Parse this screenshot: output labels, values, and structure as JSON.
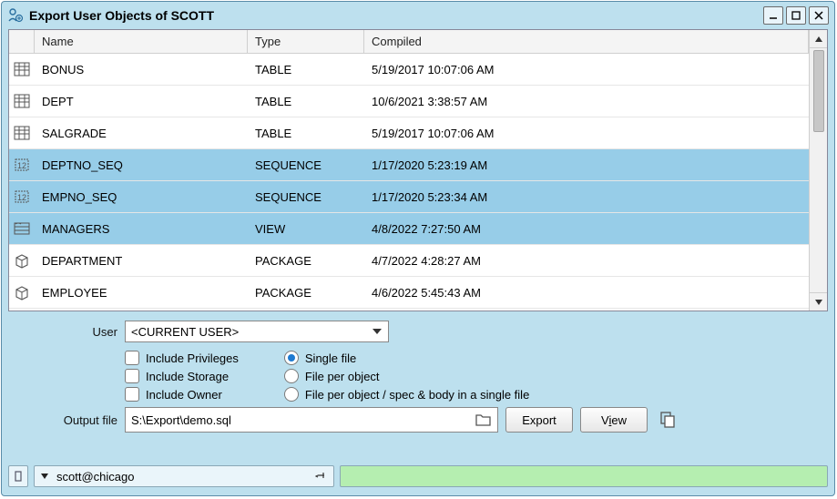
{
  "window": {
    "title": "Export User Objects of SCOTT"
  },
  "grid": {
    "headers": {
      "name": "Name",
      "type": "Type",
      "compiled": "Compiled"
    },
    "rows": [
      {
        "icon": "table",
        "name": "BONUS",
        "type": "TABLE",
        "compiled": "5/19/2017 10:07:06 AM",
        "selected": false
      },
      {
        "icon": "table",
        "name": "DEPT",
        "type": "TABLE",
        "compiled": "10/6/2021 3:38:57 AM",
        "selected": false
      },
      {
        "icon": "table",
        "name": "SALGRADE",
        "type": "TABLE",
        "compiled": "5/19/2017 10:07:06 AM",
        "selected": false
      },
      {
        "icon": "sequence",
        "name": "DEPTNO_SEQ",
        "type": "SEQUENCE",
        "compiled": "1/17/2020 5:23:19 AM",
        "selected": true
      },
      {
        "icon": "sequence",
        "name": "EMPNO_SEQ",
        "type": "SEQUENCE",
        "compiled": "1/17/2020 5:23:34 AM",
        "selected": true
      },
      {
        "icon": "view",
        "name": "MANAGERS",
        "type": "VIEW",
        "compiled": "4/8/2022 7:27:50 AM",
        "selected": true
      },
      {
        "icon": "package",
        "name": "DEPARTMENT",
        "type": "PACKAGE",
        "compiled": "4/7/2022 4:28:27 AM",
        "selected": false
      },
      {
        "icon": "package",
        "name": "EMPLOYEE",
        "type": "PACKAGE",
        "compiled": "4/6/2022 5:45:43 AM",
        "selected": false
      }
    ]
  },
  "form": {
    "user_label": "User",
    "user_value": "<CURRENT USER>",
    "include_privileges": "Include Privileges",
    "include_storage": "Include Storage",
    "include_owner": "Include Owner",
    "single_file": "Single file",
    "file_per_object": "File per object",
    "file_per_object_spec": "File per object / spec & body in a single file",
    "output_label": "Output file",
    "output_value": "S:\\Export\\demo.sql",
    "export_btn": "Export",
    "view_btn_prefix": "V",
    "view_btn_letter": "i",
    "view_btn_suffix": "ew"
  },
  "status": {
    "connection": "scott@chicago"
  }
}
